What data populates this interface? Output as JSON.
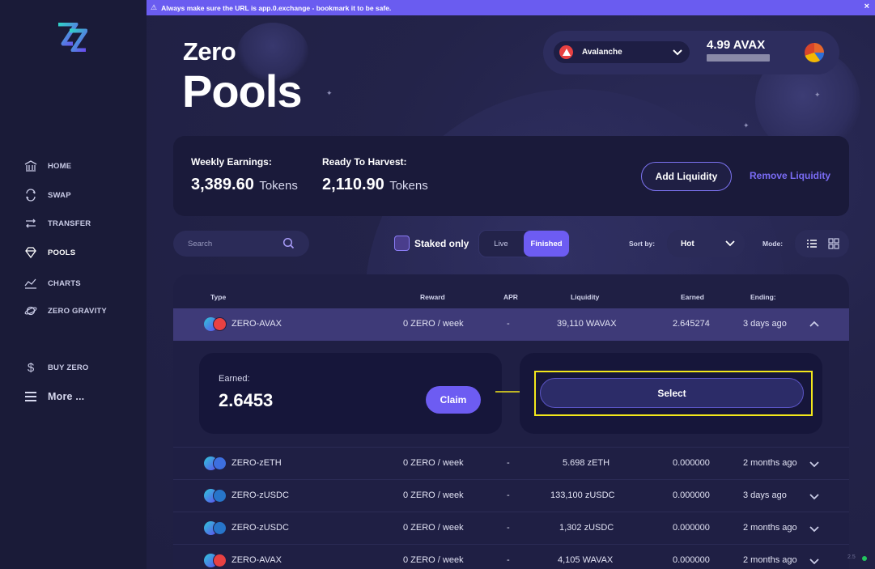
{
  "banner": {
    "text": "Always make sure the URL is app.0.exchange - bookmark it to be safe."
  },
  "sidebar": {
    "items": [
      {
        "label": "HOME"
      },
      {
        "label": "SWAP"
      },
      {
        "label": "TRANSFER"
      },
      {
        "label": "POOLS"
      },
      {
        "label": "CHARTS"
      },
      {
        "label": "ZERO GRAVITY"
      },
      {
        "label": "BUY ZERO"
      },
      {
        "label": "More ..."
      }
    ]
  },
  "header": {
    "subtitle": "Zero",
    "title": "Pools"
  },
  "wallet": {
    "network": "Avalanche",
    "balance": "4.99 AVAX"
  },
  "earnings": {
    "weekly_label": "Weekly Earnings:",
    "weekly_value": "3,389.60",
    "weekly_unit": "Tokens",
    "harvest_label": "Ready To Harvest:",
    "harvest_value": "2,110.90",
    "harvest_unit": "Tokens",
    "add_label": "Add Liquidity",
    "remove_label": "Remove Liquidity"
  },
  "filters": {
    "search_placeholder": "Search",
    "staked_label": "Staked only",
    "live_label": "Live",
    "finished_label": "Finished",
    "sortby_label": "Sort by:",
    "sort_value": "Hot",
    "mode_label": "Mode:"
  },
  "table": {
    "headers": [
      "Type",
      "Reward",
      "APR",
      "Liquidity",
      "Earned",
      "Ending:"
    ],
    "rows": [
      {
        "type": "ZERO-AVAX",
        "reward": "0 ZERO / week",
        "apr": "-",
        "liquidity": "39,110 WAVAX",
        "earned": "2.645274",
        "ending": "3 days ago"
      },
      {
        "type": "ZERO-zETH",
        "reward": "0 ZERO / week",
        "apr": "-",
        "liquidity": "5.698 zETH",
        "earned": "0.000000",
        "ending": "2 months ago"
      },
      {
        "type": "ZERO-zUSDC",
        "reward": "0 ZERO / week",
        "apr": "-",
        "liquidity": "133,100 zUSDC",
        "earned": "0.000000",
        "ending": "3 days ago"
      },
      {
        "type": "ZERO-zUSDC",
        "reward": "0 ZERO / week",
        "apr": "-",
        "liquidity": "1,302 zUSDC",
        "earned": "0.000000",
        "ending": "2 months ago"
      },
      {
        "type": "ZERO-AVAX",
        "reward": "0 ZERO / week",
        "apr": "-",
        "liquidity": "4,105 WAVAX",
        "earned": "0.000000",
        "ending": "2 months ago"
      }
    ]
  },
  "expanded": {
    "earned_label": "Earned:",
    "earned_value": "2.6453",
    "claim_label": "Claim",
    "select_label": "Select"
  },
  "footer": {
    "version": "2.5"
  },
  "colors": {
    "accent": "#6d5cf2",
    "banner": "#6a5cf0",
    "highlight": "#f3e71b",
    "avax": "#e84142"
  }
}
